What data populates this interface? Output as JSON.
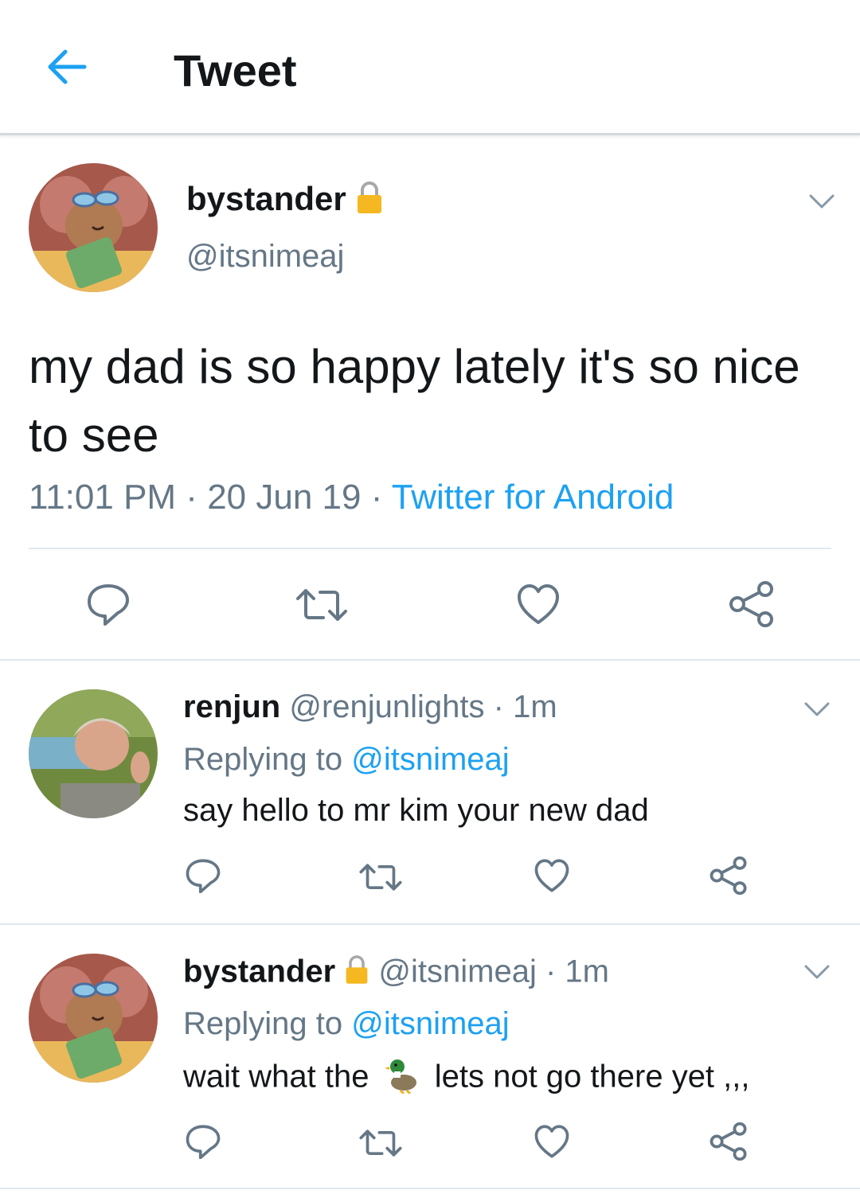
{
  "header": {
    "title": "Tweet"
  },
  "main_tweet": {
    "name": "bystander",
    "handle": "@itsnimeaj",
    "text": "my dad is so happy lately it's so nice to see",
    "time": "11:01 PM",
    "sep1": " · ",
    "date": "20 Jun 19",
    "sep2": " · ",
    "source": "Twitter for Android"
  },
  "replies": [
    {
      "name": "renjun",
      "handle": "@renjunlights",
      "age": " · 1m",
      "replying_label": "Replying to ",
      "replying_to": "@itsnimeaj",
      "text": "say hello to mr kim your new dad"
    },
    {
      "name": "bystander",
      "handle": "@itsnimeaj",
      "age": " · 1m",
      "replying_label": "Replying to ",
      "replying_to": "@itsnimeaj",
      "text_before": "wait what the",
      "text_after": "lets not go there yet ,,,"
    }
  ],
  "icons": {
    "back": "arrow-left-icon",
    "lock": "lock-icon",
    "chevron": "chevron-down-icon",
    "reply": "reply-icon",
    "retweet": "retweet-icon",
    "like": "heart-icon",
    "share": "share-icon",
    "duck": "duck-emoji"
  },
  "colors": {
    "accent": "#1da1f2",
    "secondary_text": "#657786",
    "icon_gray": "#657786",
    "divider": "#e1e8ed"
  }
}
